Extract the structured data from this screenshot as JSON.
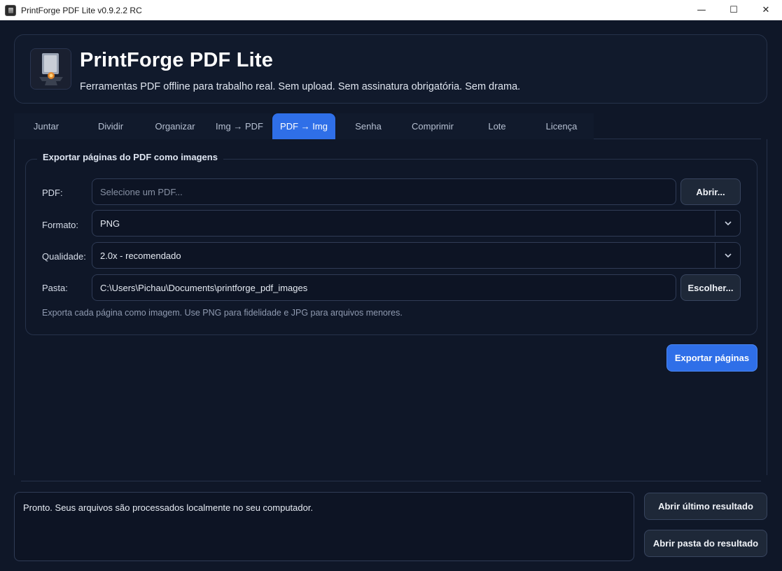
{
  "window": {
    "title": "PrintForge PDF Lite v0.9.2.2 RC",
    "minimize": "—",
    "maximize": "☐",
    "close": "✕"
  },
  "header": {
    "app_name": "PrintForge PDF Lite",
    "tagline": "Ferramentas PDF offline para trabalho real. Sem upload. Sem assinatura obrigatória. Sem drama."
  },
  "tabs": [
    {
      "label": "Juntar"
    },
    {
      "label": "Dividir"
    },
    {
      "label": "Organizar"
    },
    {
      "label": "Img → PDF"
    },
    {
      "label": "PDF → Img",
      "active": true
    },
    {
      "label": "Senha"
    },
    {
      "label": "Comprimir"
    },
    {
      "label": "Lote"
    },
    {
      "label": "Licença"
    }
  ],
  "export": {
    "group_title": "Exportar páginas do PDF como imagens",
    "pdf_label": "PDF:",
    "pdf_placeholder": "Selecione um PDF...",
    "pdf_value": "",
    "open_button": "Abrir...",
    "format_label": "Formato:",
    "format_value": "PNG",
    "quality_label": "Qualidade:",
    "quality_value": "2.0x - recomendado",
    "folder_label": "Pasta:",
    "folder_value": "C:\\Users\\Pichau\\Documents\\printforge_pdf_images",
    "choose_button": "Escolher...",
    "hint": "Exporta cada página como imagem. Use PNG para fidelidade e JPG para arquivos menores.",
    "export_button": "Exportar páginas"
  },
  "status": {
    "message": "Pronto. Seus arquivos são processados localmente no seu computador.",
    "open_last_button": "Abrir último resultado",
    "open_folder_button": "Abrir pasta do resultado"
  },
  "colors": {
    "background": "#0f1728",
    "accent": "#2f6fe8",
    "border": "#26324a"
  }
}
